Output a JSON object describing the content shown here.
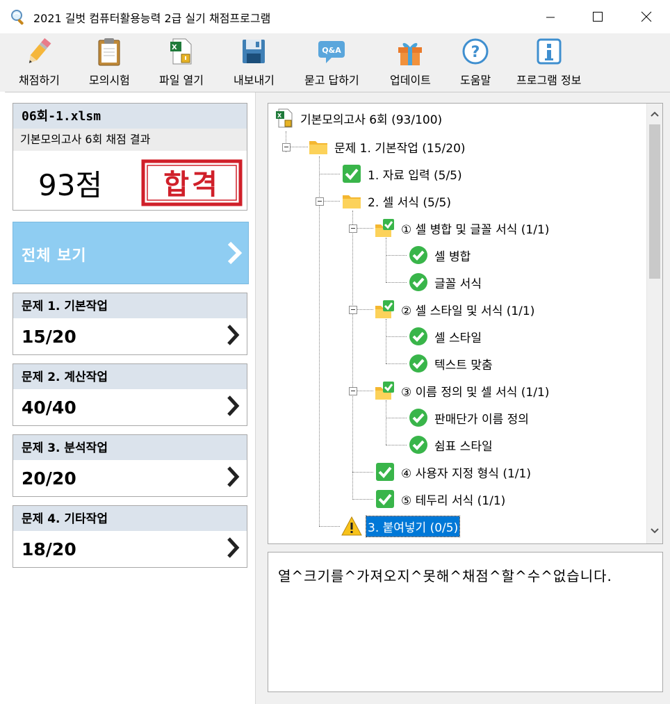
{
  "window": {
    "title": "2021 길벗 컴퓨터활용능력 2급 실기 채점프로그램"
  },
  "toolbar": {
    "items": [
      {
        "label": "채점하기",
        "icon": "pencil-icon"
      },
      {
        "label": "모의시험",
        "icon": "clipboard-icon"
      },
      {
        "label": "파일 열기",
        "icon": "excel-file-icon"
      },
      {
        "label": "내보내기",
        "icon": "floppy-disk-icon"
      },
      {
        "label": "묻고 답하기",
        "icon": "qa-bubble-icon"
      },
      {
        "label": "업데이트",
        "icon": "gift-icon"
      },
      {
        "label": "도움말",
        "icon": "help-icon"
      },
      {
        "label": "프로그램 정보",
        "icon": "info-icon"
      }
    ],
    "qa_icon_text": "Q&A"
  },
  "score_card": {
    "file_name": "06회-1.xlsm",
    "subtitle": "기본모의고사 6회 채점 결과",
    "score": "93점",
    "result_stamp": "합격"
  },
  "full_view": {
    "label": "전체 보기"
  },
  "sections": [
    {
      "title": "문제 1. 기본작업",
      "score": "15/20"
    },
    {
      "title": "문제 2. 계산작업",
      "score": "40/40"
    },
    {
      "title": "문제 3. 분석작업",
      "score": "20/20"
    },
    {
      "title": "문제 4. 기타작업",
      "score": "18/20"
    }
  ],
  "tree": {
    "root": "기본모의고사 6회 (93/100)",
    "nodes": [
      {
        "text": "문제 1. 기본작업 (15/20)",
        "icon": "folder-icon"
      },
      {
        "text": "1. 자료 입력 (5/5)",
        "icon": "check-box-icon"
      },
      {
        "text": "2. 셀 서식 (5/5)",
        "icon": "folder-icon"
      },
      {
        "text": "① 셀 병합 및 글꼴 서식 (1/1)",
        "icon": "folder-check-icon"
      },
      {
        "text": "셀 병합",
        "icon": "check-circle-icon"
      },
      {
        "text": "글꼴 서식",
        "icon": "check-circle-icon"
      },
      {
        "text": "② 셀 스타일 및 서식 (1/1)",
        "icon": "folder-check-icon"
      },
      {
        "text": "셀 스타일",
        "icon": "check-circle-icon"
      },
      {
        "text": "텍스트 맞춤",
        "icon": "check-circle-icon"
      },
      {
        "text": "③ 이름 정의 및 셀 서식 (1/1)",
        "icon": "folder-check-icon"
      },
      {
        "text": "판매단가 이름 정의",
        "icon": "check-circle-icon"
      },
      {
        "text": "쉼표 스타일",
        "icon": "check-circle-icon"
      },
      {
        "text": "④ 사용자 지정 형식 (1/1)",
        "icon": "check-box-icon"
      },
      {
        "text": "⑤ 테두리 서식 (1/1)",
        "icon": "check-box-icon"
      },
      {
        "text": "3. 붙여넣기 (0/5)",
        "icon": "warning-icon",
        "selected": true
      }
    ]
  },
  "message": {
    "text": "열^크기를^가져오지^못해^채점^할^수^없습니다."
  },
  "colors": {
    "accent_blue": "#8fcdf2",
    "header_gray": "#dbe3ec",
    "stamp_red": "#d0202a",
    "check_green": "#39b54a",
    "selection_blue": "#0078d7"
  }
}
